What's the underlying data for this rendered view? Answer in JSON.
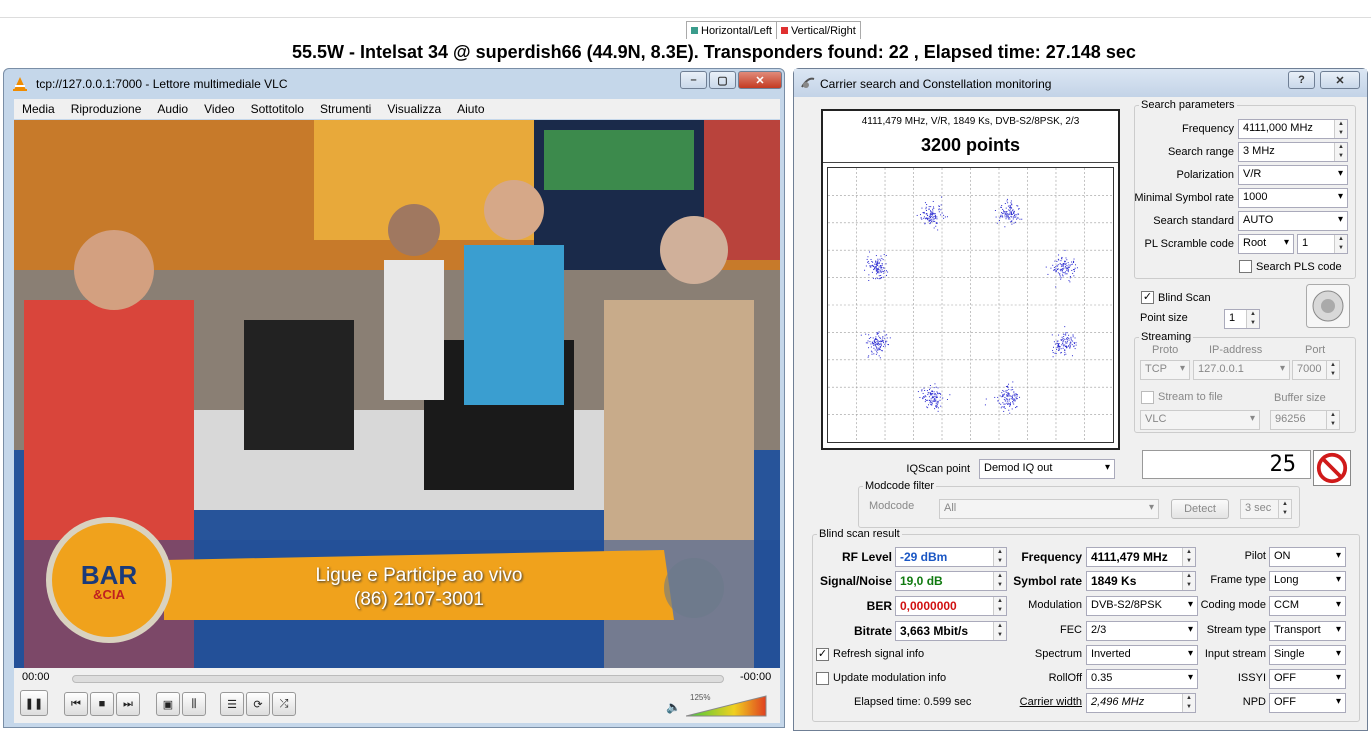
{
  "legend": {
    "horizontal": {
      "label": "Horizontal/Left",
      "color": "#3a9c8c"
    },
    "vertical": {
      "label": "Vertical/Right",
      "color": "#e03030"
    }
  },
  "headline": "55.5W - Intelsat 34 @ superdish66 (44.9N, 8.3E). Transponders found: 22 , Elapsed time: 27.148 sec",
  "vlc": {
    "title": "tcp://127.0.0.1:7000 - Lettore multimediale VLC",
    "menu": [
      "Media",
      "Riproduzione",
      "Audio",
      "Video",
      "Sottotitolo",
      "Strumenti",
      "Visualizza",
      "Aiuto"
    ],
    "time_elapsed": "00:00",
    "time_remaining": "-00:00",
    "volume": "125%",
    "video": {
      "logo_line1": "BAR",
      "logo_line2": "&CIA",
      "banner_line1": "Ligue e Participe ao vivo",
      "banner_line2": "(86) 2107-3001"
    }
  },
  "panel": {
    "title": "Carrier search and Constellation monitoring",
    "help_btn": "?",
    "close_btn": "✕",
    "plot": {
      "info": "4111,479 MHz, V/R, 1849 Ks, DVB-S2/8PSK, 2/3",
      "points": "3200 points"
    },
    "search": {
      "legend": "Search parameters",
      "frequency_label": "Frequency",
      "frequency_value": "4111,000 MHz",
      "range_label": "Search range",
      "range_value": "3 MHz",
      "polarization_label": "Polarization",
      "polarization_value": "V/R",
      "min_sr_label": "Minimal Symbol rate",
      "min_sr_value": "1000",
      "standard_label": "Search standard",
      "standard_value": "AUTO",
      "pls_label": "PL Scramble code",
      "pls_mode": "Root",
      "pls_value": "1",
      "search_pls_label": "Search PLS code"
    },
    "blind_scan_label": "Blind Scan",
    "point_size_label": "Point size",
    "point_size_value": "1",
    "streaming": {
      "legend": "Streaming",
      "proto_label": "Proto",
      "ip_label": "IP-address",
      "port_label": "Port",
      "proto_value": "TCP",
      "ip_value": "127.0.0.1",
      "port_value": "7000",
      "to_file_label": "Stream to file",
      "buffer_label": "Buffer size",
      "player_value": "VLC",
      "buffer_value": "96256"
    },
    "iq_label": "IQScan point",
    "iq_value": "Demod IQ out",
    "counter": "25",
    "modcode": {
      "legend": "Modcode filter",
      "label": "Modcode",
      "value": "All",
      "detect": "Detect",
      "interval": "3 sec"
    },
    "result": {
      "legend": "Blind scan result",
      "rf_label": "RF Level",
      "rf_value": "-29 dBm",
      "sn_label": "Signal/Noise",
      "sn_value": "19,0 dB",
      "ber_label": "BER",
      "ber_value": "0,0000000",
      "bitrate_label": "Bitrate",
      "bitrate_value": "3,663 Mbit/s",
      "freq_label": "Frequency",
      "freq_value": "4111,479 MHz",
      "sr_label": "Symbol rate",
      "sr_value": "1849 Ks",
      "mod_label": "Modulation",
      "mod_value": "DVB-S2/8PSK",
      "fec_label": "FEC",
      "fec_value": "2/3",
      "spectrum_label": "Spectrum",
      "spectrum_value": "Inverted",
      "rolloff_label": "RollOff",
      "rolloff_value": "0.35",
      "carrier_label": "Carrier width",
      "carrier_value": "2,496 MHz",
      "pilot_label": "Pilot",
      "pilot_value": "ON",
      "frame_label": "Frame type",
      "frame_value": "Long",
      "coding_label": "Coding mode",
      "coding_value": "CCM",
      "stream_label": "Stream type",
      "stream_value": "Transport",
      "input_label": "Input stream",
      "input_value": "Single",
      "issyi_label": "ISSYI",
      "issyi_value": "OFF",
      "npd_label": "NPD",
      "npd_value": "OFF",
      "refresh_label": "Refresh signal info",
      "update_label": "Update modulation info",
      "elapsed": "Elapsed time: 0.599 sec"
    },
    "colors": {
      "rf": "#1a56c4",
      "sn": "#107a10",
      "ber": "#d01010",
      "points": "#2a2ad0"
    }
  }
}
